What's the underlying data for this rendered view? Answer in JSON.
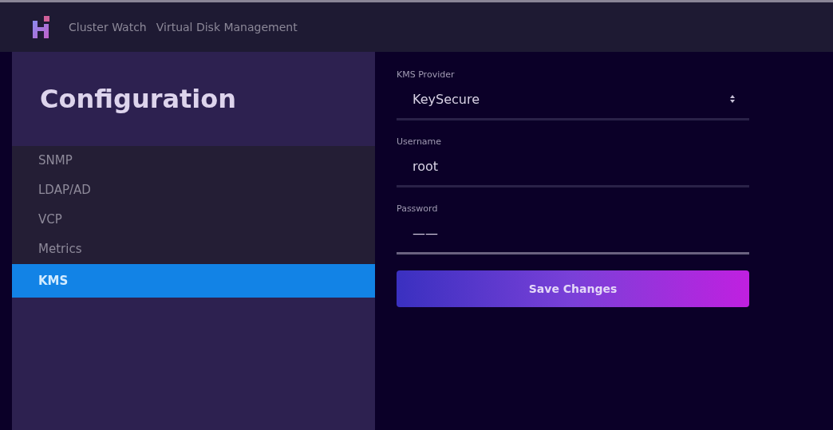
{
  "header": {
    "nav": [
      "Cluster Watch",
      "Virtual Disk Management"
    ]
  },
  "sidebar": {
    "title": "Configuration",
    "items": [
      {
        "label": "SNMP",
        "selected": false
      },
      {
        "label": "LDAP/AD",
        "selected": false
      },
      {
        "label": "VCP",
        "selected": false
      },
      {
        "label": "Metrics",
        "selected": false
      },
      {
        "label": "KMS",
        "selected": true
      }
    ]
  },
  "form": {
    "fields": [
      {
        "kind": "select",
        "label": "KMS Provider",
        "value": "KeySecure"
      },
      {
        "kind": "text",
        "label": "Username",
        "value": "root"
      },
      {
        "kind": "password",
        "label": "Password",
        "value": "——"
      }
    ],
    "button": "Save Changes"
  }
}
